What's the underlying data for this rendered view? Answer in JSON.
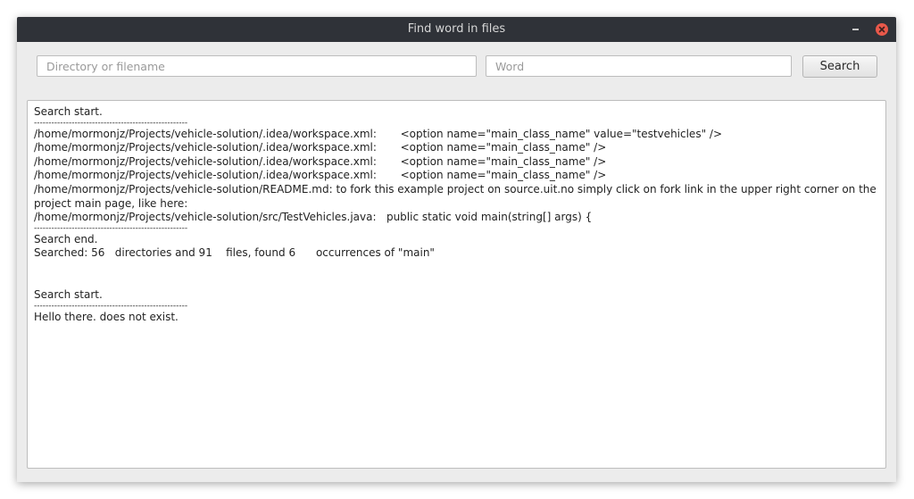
{
  "window": {
    "title": "Find word in files"
  },
  "toolbar": {
    "directory_placeholder": "Directory or filename",
    "directory_value": "",
    "word_placeholder": "Word",
    "word_value": "",
    "search_label": "Search"
  },
  "results": {
    "lines": [
      "Search start.",
      "-----------------------------------------------------",
      "/home/mormonjz/Projects/vehicle-solution/.idea/workspace.xml:       <option name=\"main_class_name\" value=\"testvehicles\" />",
      "/home/mormonjz/Projects/vehicle-solution/.idea/workspace.xml:       <option name=\"main_class_name\" />",
      "/home/mormonjz/Projects/vehicle-solution/.idea/workspace.xml:       <option name=\"main_class_name\" />",
      "/home/mormonjz/Projects/vehicle-solution/.idea/workspace.xml:       <option name=\"main_class_name\" />",
      "/home/mormonjz/Projects/vehicle-solution/README.md: to fork this example project on source.uit.no simply click on fork link in the upper right corner on the project main page, like here:",
      "/home/mormonjz/Projects/vehicle-solution/src/TestVehicles.java:   public static void main(string[] args) {",
      "-----------------------------------------------------",
      "Search end.",
      "Searched: 56   directories and 91    files, found 6      occurrences of \"main\"",
      "",
      "",
      "Search start.",
      "-----------------------------------------------------",
      "Hello there. does not exist."
    ]
  }
}
